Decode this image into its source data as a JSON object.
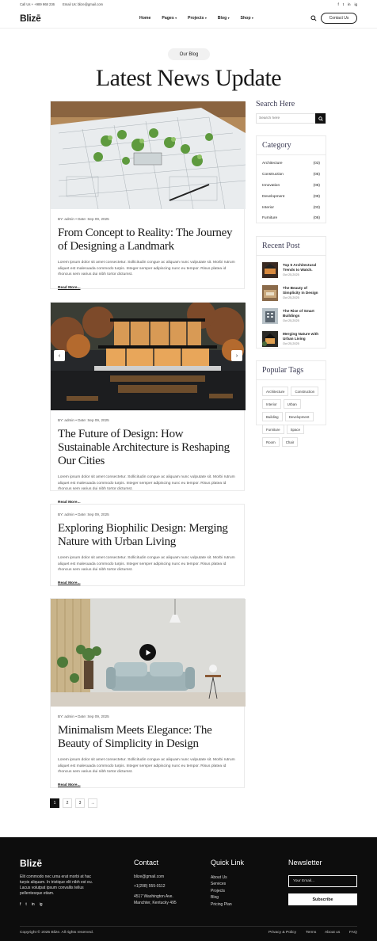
{
  "topbar": {
    "call": "Call Us + +989 968 236",
    "email": "Email Us: blize@gmail.com",
    "social": [
      "f",
      "t",
      "in",
      "ig"
    ]
  },
  "header": {
    "logo": "Blizē",
    "nav": [
      {
        "label": "Home",
        "dropdown": false
      },
      {
        "label": "Pages",
        "dropdown": true
      },
      {
        "label": "Projects",
        "dropdown": true
      },
      {
        "label": "Blog",
        "dropdown": true
      },
      {
        "label": "Shop",
        "dropdown": true
      }
    ],
    "contact_button": "Contact Us"
  },
  "hero": {
    "badge": "Our Blog",
    "title": "Latest News Update"
  },
  "posts": [
    {
      "meta": "BY: admin  •  Date: Sep 09, 2025",
      "title": "From Concept to Reality: The Journey of Designing a Landmark",
      "excerpt": "Lorem ipsum dolor sit amet consectetur. Sollicitudin congue ac aliquam nunc vulputate sit. Morbi rutrum aliquet est malesuada commodo turpis. Integer semper adipiscing nunc eu tempor. Risus platea id rhoncus sem varius dui nibh tortor dictumst.",
      "read_more": "Read More..."
    },
    {
      "meta": "BY: admin  •  Date: Sep 09, 2025",
      "title": "The Future of Design: How Sustainable Architecture is Reshaping Our Cities",
      "excerpt": "Lorem ipsum dolor sit amet consectetur. Sollicitudin congue ac aliquam nunc vulputate sit. Morbi rutrum aliquet est malesuada commodo turpis. Integer semper adipiscing nunc eu tempor. Risus platea id rhoncus sem varius dui nibh tortor dictumst.",
      "read_more": "Read More..."
    },
    {
      "meta": "BY: admin  •  Date: Sep 09, 2025",
      "title": "Exploring Biophilic Design: Merging Nature with Urban Living",
      "excerpt": "Lorem ipsum dolor sit amet consectetur. Sollicitudin congue ac aliquam nunc vulputate sit. Morbi rutrum aliquet est malesuada commodo turpis. Integer semper adipiscing nunc eu tempor. Risus platea id rhoncus sem varius dui nibh tortor dictumst.",
      "read_more": "Read More..."
    },
    {
      "meta": "BY: admin  •  Date: Sep 09, 2025",
      "title": "Minimalism Meets Elegance: The Beauty of Simplicity in Design",
      "excerpt": "Lorem ipsum dolor sit amet consectetur. Sollicitudin congue ac aliquam nunc vulputate sit. Morbi rutrum aliquet est malesuada commodo turpis. Integer semper adipiscing nunc eu tempor. Risus platea id rhoncus sem varius dui nibh tortor dictumst.",
      "read_more": "Read More..."
    }
  ],
  "sidebar": {
    "search_title": "Search Here",
    "search_placeholder": "Search here",
    "category_title": "Category",
    "categories": [
      {
        "name": "Architecture",
        "count": "(03)"
      },
      {
        "name": "Construction",
        "count": "(05)"
      },
      {
        "name": "Innovation",
        "count": "(06)"
      },
      {
        "name": "Development",
        "count": "(09)"
      },
      {
        "name": "Interior",
        "count": "(03)"
      },
      {
        "name": "Furniture",
        "count": "(06)"
      }
    ],
    "recent_title": "Recent Post",
    "recent": [
      {
        "title": "Top 5 Architectural Trends to Watch.",
        "date": "Oct 25,2025"
      },
      {
        "title": "The Beauty of Simplicity in Design",
        "date": "Oct 25,2025"
      },
      {
        "title": "The Rise of Smart Buildings",
        "date": "Oct 25,2025"
      },
      {
        "title": "Merging Nature with Urban Living",
        "date": "Oct 25,2025"
      }
    ],
    "tags_title": "Popular Tags",
    "tags": [
      "Architecture",
      "Construction",
      "Interior",
      "Urban",
      "Building",
      "Development",
      "Furniture",
      "Space",
      "Room",
      "Chair"
    ]
  },
  "pagination": [
    "1",
    "2",
    "3",
    "→"
  ],
  "footer": {
    "logo": "Blizē",
    "description": "Elit commodo nec urna erat morbi at hac turpis aliquam. In tristique elit nibh est eu. Lacus volutpat ipsum convallis tellus pellentesque etiam.",
    "social": [
      "f",
      "t",
      "in",
      "ig"
    ],
    "contact_title": "Contact",
    "contact_email": "blize@gmail.com",
    "contact_phone": "+1(208) 555-0112",
    "contact_address_1": "4517 Washington Ave.",
    "contact_address_2": "Manchter, Kentucky 495",
    "quick_title": "Quick Link",
    "quick_links": [
      "About Us",
      "Services",
      "Projects",
      "Blog",
      "Pricing Plan"
    ],
    "newsletter_title": "Newsletter",
    "newsletter_placeholder": "Your Email...",
    "subscribe": "Subscribe",
    "copyright": "Copyright © 2025 Blize. All rights reserved.",
    "bottom_links": [
      "Privacy & Policy",
      "Terms",
      "About us",
      "FAQ"
    ]
  }
}
